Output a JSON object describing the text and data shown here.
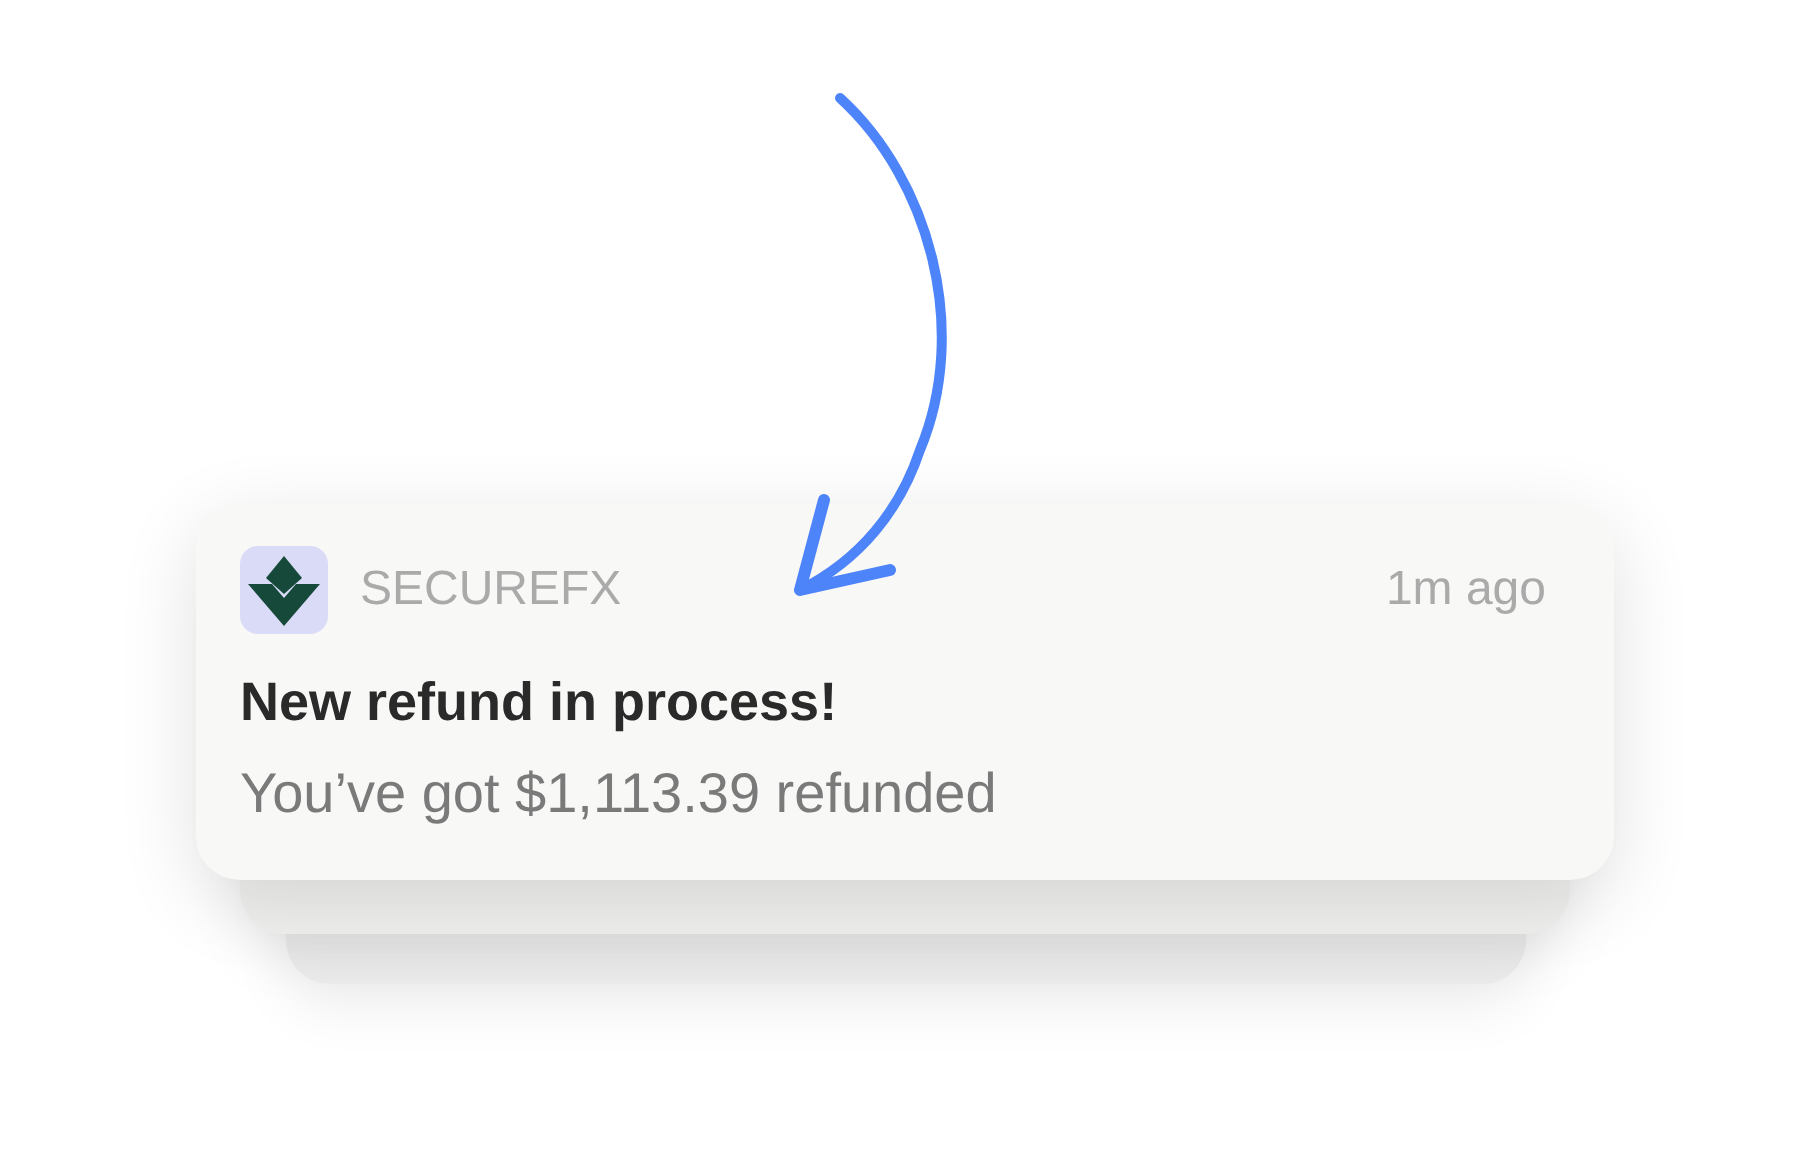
{
  "notification": {
    "app_name": "SECUREFX",
    "time": "1m ago",
    "title": "New refund in process!",
    "body": "You’ve got $1,113.39 refunded"
  }
}
